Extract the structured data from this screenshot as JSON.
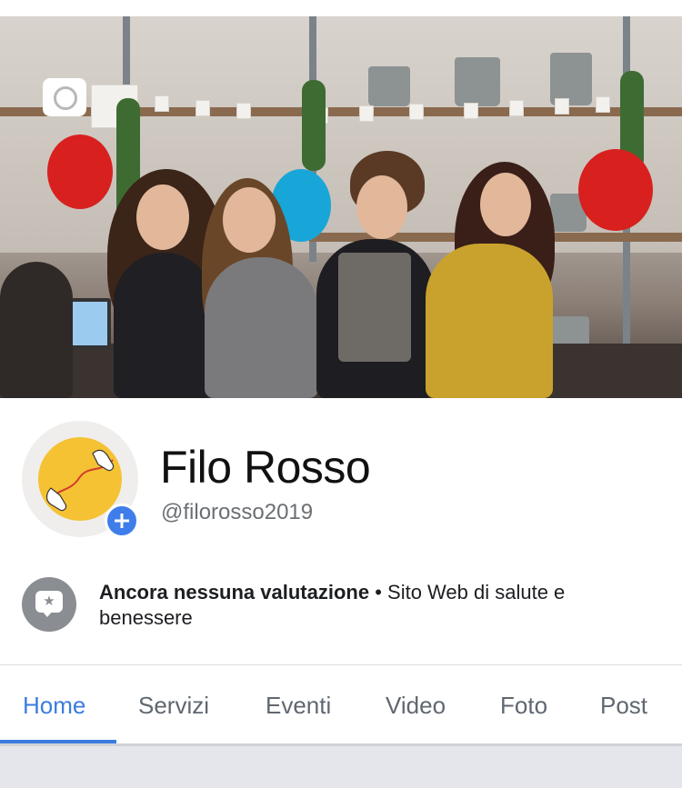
{
  "profile": {
    "name": "Filo Rosso",
    "handle": "@filorosso2019"
  },
  "rating": {
    "status": "Ancora nessuna valutazione",
    "separator": " • ",
    "category": "Sito Web di salute e benessere"
  },
  "tabs": [
    {
      "label": "Home",
      "active": true
    },
    {
      "label": "Servizi",
      "active": false
    },
    {
      "label": "Eventi",
      "active": false
    },
    {
      "label": "Video",
      "active": false
    },
    {
      "label": "Foto",
      "active": false
    },
    {
      "label": "Post",
      "active": false
    }
  ],
  "icons": {
    "camera": "camera-icon",
    "add": "plus-icon",
    "rating": "rating-star-bubble-icon"
  },
  "colors": {
    "accent": "#3b7ce0",
    "tab_inactive": "#606770",
    "text": "#1c1e21",
    "handle": "#6b6f73"
  }
}
